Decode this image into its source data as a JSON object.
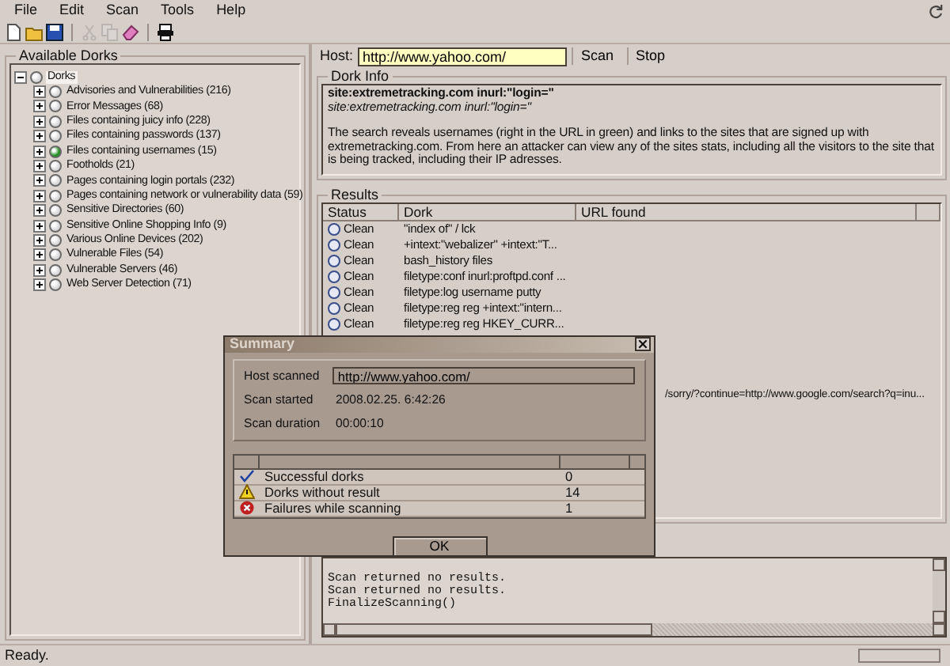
{
  "menu": [
    "File",
    "Edit",
    "Scan",
    "Tools",
    "Help"
  ],
  "toolbar": [
    [
      {
        "kind": "new",
        "disabled": false
      },
      {
        "kind": "open",
        "disabled": false
      },
      {
        "kind": "save",
        "disabled": false
      }
    ],
    [
      {
        "kind": "cut",
        "disabled": true
      },
      {
        "kind": "copy",
        "disabled": true
      },
      {
        "kind": "eraser",
        "disabled": false
      }
    ],
    [
      {
        "kind": "proxy",
        "disabled": false
      }
    ]
  ],
  "tree": {
    "title": "Available Dorks",
    "root": {
      "label": "Dorks",
      "expanded": true,
      "selected": true,
      "children": [
        {
          "label": "Advisories and Vulnerabilities (216)",
          "color": "#d8d8d8",
          "expanded": false,
          "selected": false
        },
        {
          "label": "Error Messages (68)",
          "color": "#d8d8d8",
          "expanded": false,
          "selected": false
        },
        {
          "label": "Files containing juicy info (228)",
          "color": "#d8d8d8",
          "expanded": false,
          "selected": false
        },
        {
          "label": "Files containing passwords (137)",
          "color": "#d8d8d8",
          "expanded": false,
          "selected": false
        },
        {
          "label": "Files containing usernames (15)",
          "color": "#1f8f1f",
          "expanded": false,
          "selected": false
        },
        {
          "label": "Footholds (21)",
          "color": "#d8d8d8",
          "expanded": false,
          "selected": false
        },
        {
          "label": "Pages containing login portals (232)",
          "color": "#d8d8d8",
          "expanded": false,
          "selected": false
        },
        {
          "label": "Pages containing network or vulnerability data (59)",
          "color": "#d8d8d8",
          "expanded": false,
          "selected": false
        },
        {
          "label": "Sensitive Directories (60)",
          "color": "#d8d8d8",
          "expanded": false,
          "selected": false
        },
        {
          "label": "Sensitive Online Shopping Info (9)",
          "color": "#d8d8d8",
          "expanded": false,
          "selected": false
        },
        {
          "label": "Various Online Devices (202)",
          "color": "#d8d8d8",
          "expanded": false,
          "selected": false
        },
        {
          "label": "Vulnerable Files (54)",
          "color": "#d8d8d8",
          "expanded": false,
          "selected": false
        },
        {
          "label": "Vulnerable Servers (46)",
          "color": "#d8d8d8",
          "expanded": false,
          "selected": false
        },
        {
          "label": "Web Server Detection (71)",
          "color": "#d8d8d8",
          "expanded": false,
          "selected": false
        }
      ]
    }
  },
  "host": {
    "label": "Host:",
    "value": "http://www.yahoo.com/",
    "buttons": [
      "Scan",
      "Stop"
    ]
  },
  "dork_info": {
    "title": "Dork Info",
    "query": "site:extremetracking.com inurl:\"login=\"",
    "query_italic": "site:extremetracking.com inurl:\"login=\"",
    "description": "The search reveals usernames (right in the URL in green) and links to the sites that are signed up with extremetracking.com. From here an attacker can view any of the sites stats, including all the visitors to the site that is being tracked, including their IP adresses."
  },
  "results": {
    "title": "Results",
    "columns": [
      "Status",
      "Dork",
      "URL found"
    ],
    "rows": [
      {
        "status": "Clean",
        "dork": "\"index of\" / lck"
      },
      {
        "status": "Clean",
        "dork": "+intext:\"webalizer\" +intext:\"T..."
      },
      {
        "status": "Clean",
        "dork": "bash_history files"
      },
      {
        "status": "Clean",
        "dork": "filetype:conf inurl:proftpd.conf ..."
      },
      {
        "status": "Clean",
        "dork": "filetype:log username putty"
      },
      {
        "status": "Clean",
        "dork": "filetype:reg reg +intext:\"intern..."
      },
      {
        "status": "Clean",
        "dork": "filetype:reg reg HKEY_CURR..."
      },
      {
        "url": "/sorry/?continue=http://www.google.com/search?q=inu..."
      }
    ]
  },
  "log": [
    "Scan returned no results.",
    "Scan returned no results.",
    "FinalizeScanning()"
  ],
  "status_bar": "Ready.",
  "dialog": {
    "title": "Summary",
    "fields": [
      {
        "label": "Host scanned",
        "value": "http://www.yahoo.com/",
        "kind": "field"
      },
      {
        "label": "Scan started",
        "value": "2008.02.25. 6:42:26",
        "kind": "text"
      },
      {
        "label": "Scan duration",
        "value": "00:00:10",
        "kind": "text"
      }
    ],
    "rows": [
      {
        "kind": "success",
        "label": "Successful dorks",
        "value": "0"
      },
      {
        "kind": "warning",
        "label": "Dorks without result",
        "value": "14"
      },
      {
        "kind": "error",
        "label": "Failures while scanning",
        "value": "1"
      }
    ],
    "button": "OK"
  }
}
